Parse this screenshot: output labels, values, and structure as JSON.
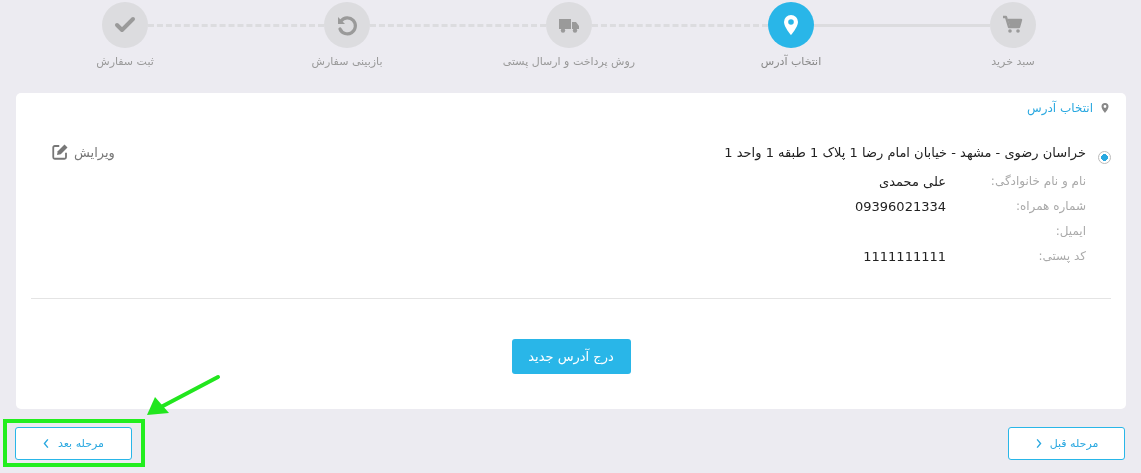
{
  "steps": [
    {
      "label": "سبد خرید",
      "selected": false
    },
    {
      "label": "انتخاب آدرس",
      "selected": true
    },
    {
      "label": "روش پرداخت و ارسال پستی",
      "selected": false
    },
    {
      "label": "بازبینی سفارش",
      "selected": false
    },
    {
      "label": "ثبت سفارش",
      "selected": false
    }
  ],
  "card": {
    "title": "انتخاب آدرس",
    "addresses": [
      {
        "selected": true,
        "address": "خراسان رضوی - مشهد - خیابان امام رضا 1 پلاک 1 طبقه 1 واحد 1",
        "edit_label": "ویرایش",
        "fields": [
          {
            "label": "نام و نام خانوادگی:",
            "value": "علی محمدی"
          },
          {
            "label": "شماره همراه:",
            "value": "09396021334"
          },
          {
            "label": "ایمیل:"
          },
          {
            "label": "کد پستی:",
            "value": "1111111111"
          }
        ]
      }
    ],
    "add_button": "درج آدرس جدید"
  },
  "nav": {
    "previous": {
      "label": "مرحله قبل",
      "highlighted": false
    },
    "next": {
      "label": "مرحله بعد",
      "highlighted": true
    }
  }
}
